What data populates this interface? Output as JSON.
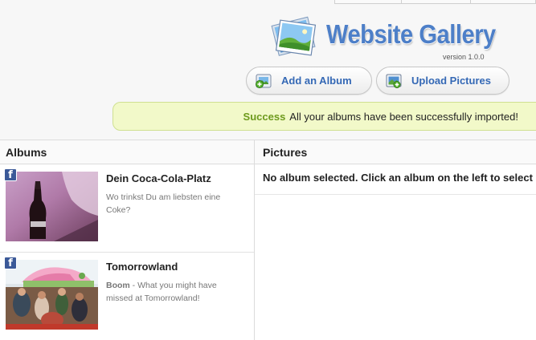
{
  "app": {
    "title": "Website Gallery",
    "version": "version 1.0.0"
  },
  "toolbar": {
    "add_album_label": "Add an Album",
    "upload_pictures_label": "Upload Pictures"
  },
  "alert": {
    "status": "Success",
    "message": "All your albums have been successfully imported!"
  },
  "albums": {
    "heading": "Albums",
    "items": [
      {
        "title": "Dein Coca-Cola-Platz",
        "author": "",
        "description": "Wo trinkst Du am liebsten eine Coke?",
        "source_icon": "facebook-icon"
      },
      {
        "title": "Tomorrowland",
        "author": "Boom",
        "description": " - What you might have missed at Tomorrowland!",
        "source_icon": "facebook-icon"
      }
    ]
  },
  "pictures": {
    "heading": "Pictures",
    "empty_message": "No album selected. Click an album on the left to select it."
  },
  "colors": {
    "accent": "#3468b5",
    "success": "#6d9a1c",
    "alert_bg": "#f2f9c9",
    "facebook": "#3b5998"
  }
}
